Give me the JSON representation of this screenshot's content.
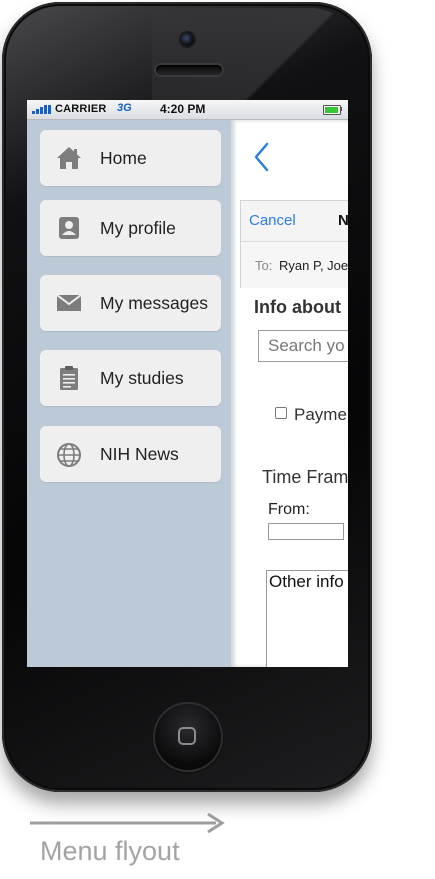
{
  "status_bar": {
    "carrier": "CARRIER",
    "network": "3G",
    "time": "4:20 PM"
  },
  "menu": {
    "items": [
      {
        "label": "Home",
        "icon": "home-icon"
      },
      {
        "label": "My profile",
        "icon": "profile-icon"
      },
      {
        "label": "My messages",
        "icon": "envelope-icon"
      },
      {
        "label": "My studies",
        "icon": "clipboard-icon"
      },
      {
        "label": "NIH News",
        "icon": "globe-icon"
      }
    ],
    "background_color": "#bccad7"
  },
  "main": {
    "compose": {
      "cancel_label": "Cancel",
      "title": "N",
      "to_label": "To:",
      "to_value": "Ryan P, Joe"
    },
    "info_heading": "Info about",
    "search_placeholder": "Search yo",
    "checkbox_label": "Payme",
    "time_frame_label": "Time Fram",
    "from_label": "From:",
    "from_value": "",
    "other_info_text": "Other info"
  },
  "annotation": {
    "caption": "Menu flyout"
  },
  "colors": {
    "accent": "#2a7de1",
    "menu_item_bg": "#efefef"
  }
}
